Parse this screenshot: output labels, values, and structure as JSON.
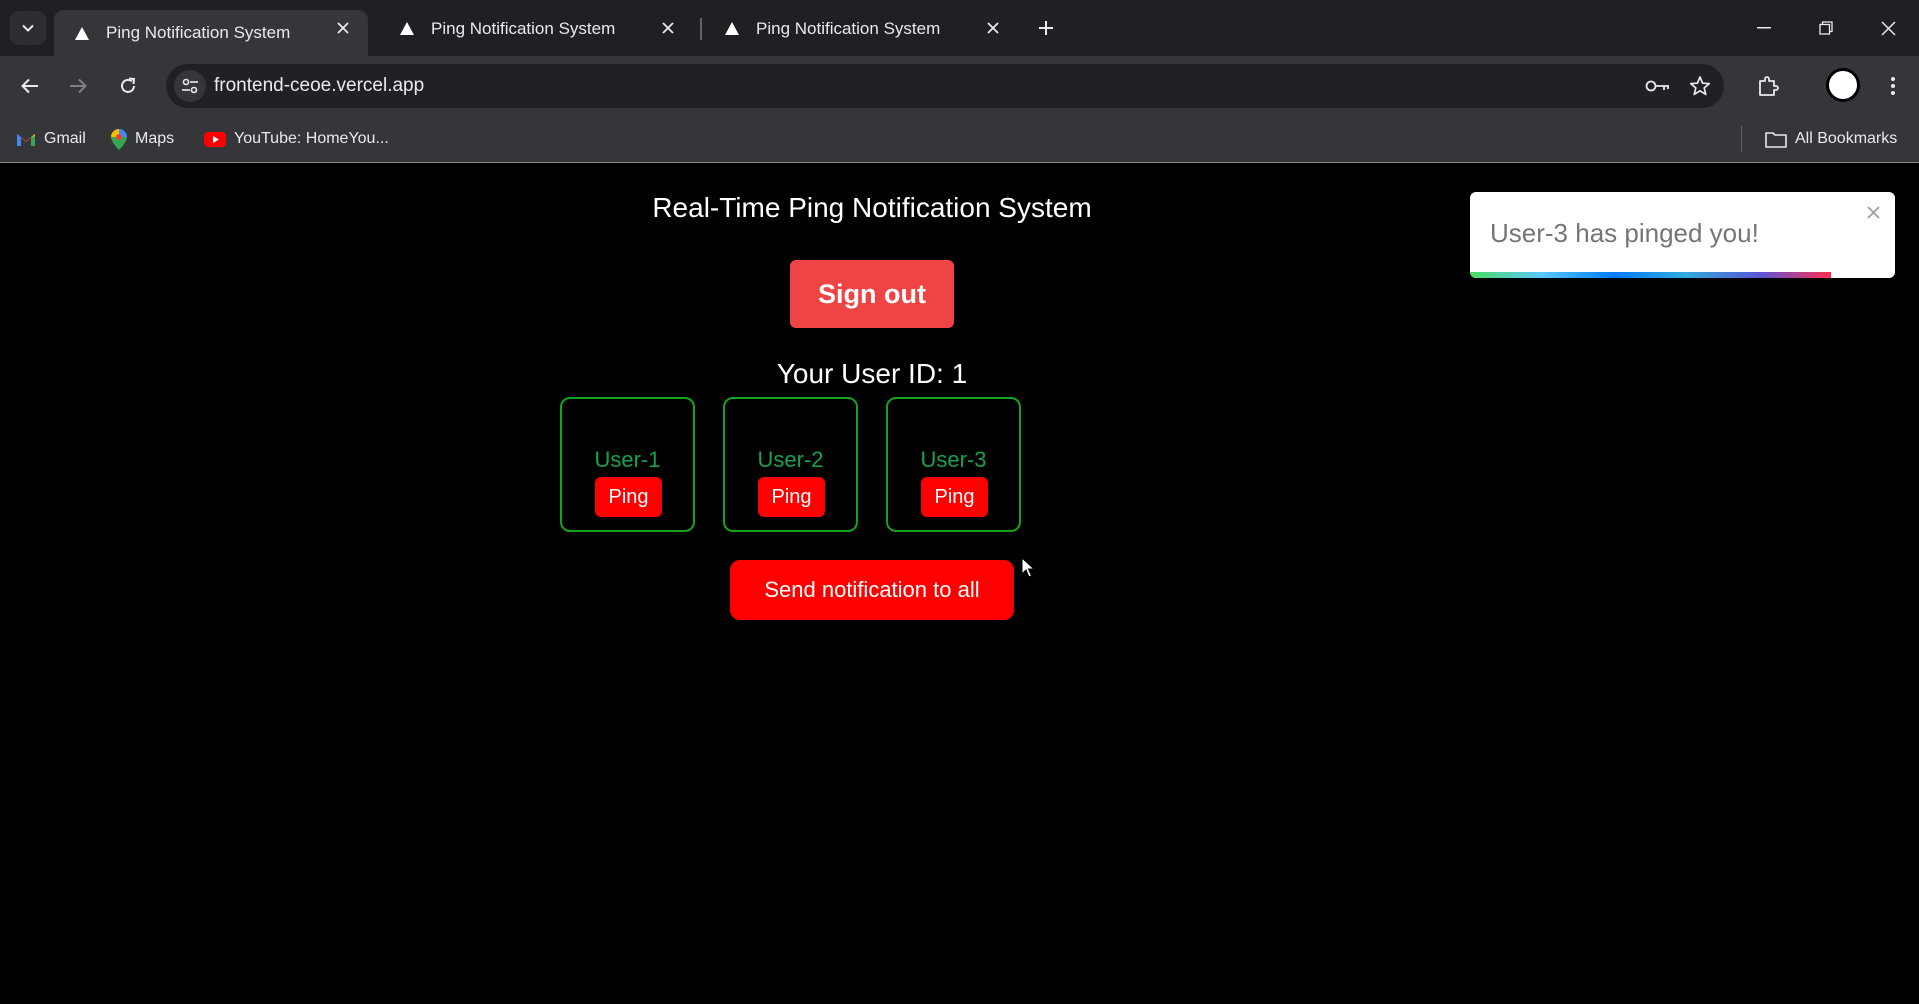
{
  "tabs": [
    {
      "title": "Ping Notification System",
      "active": true
    },
    {
      "title": "Ping Notification System",
      "active": false
    },
    {
      "title": "Ping Notification System",
      "active": false
    }
  ],
  "address_bar": {
    "url": "frontend-ceoe.vercel.app"
  },
  "bookmarks": {
    "items": [
      {
        "label": "Gmail",
        "icon": "gmail-icon"
      },
      {
        "label": "Maps",
        "icon": "maps-icon"
      },
      {
        "label": "YouTube: HomeYou...",
        "icon": "youtube-icon"
      }
    ],
    "all_bookmarks_label": "All Bookmarks"
  },
  "main": {
    "title": "Real-Time Ping Notification System",
    "signout_label": "Sign out",
    "user_id_text": "Your User ID: 1",
    "users": [
      {
        "name": "User-1",
        "ping_label": "Ping"
      },
      {
        "name": "User-2",
        "ping_label": "Ping"
      },
      {
        "name": "User-3",
        "ping_label": "Ping"
      }
    ],
    "send_all_label": "Send notification to all"
  },
  "toast": {
    "message": "User-3 has pinged you!",
    "progress_fraction": 0.85
  },
  "colors": {
    "primary_red": "#ff0000",
    "signout_red": "#ef4444",
    "user_green": "#16a34a",
    "background": "#000000"
  }
}
